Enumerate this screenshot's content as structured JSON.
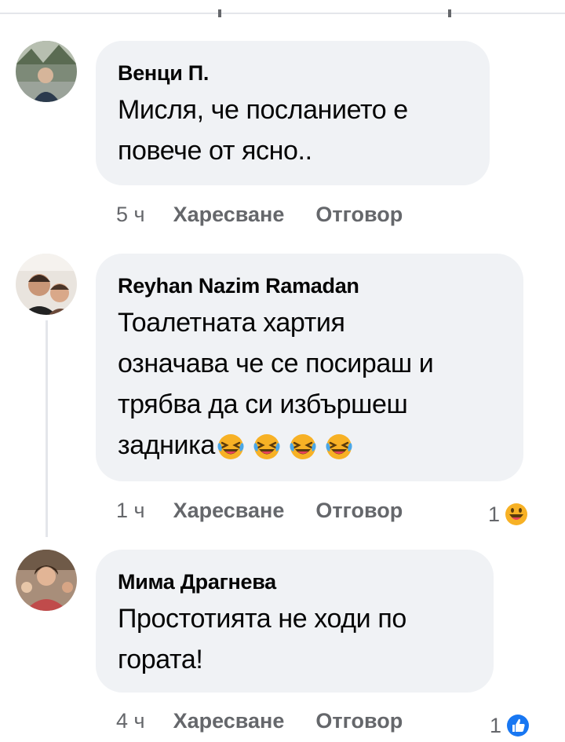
{
  "comments": [
    {
      "author": "Венци П.",
      "lines": [
        "Мисля, че посланието е",
        "повече от ясно.."
      ],
      "time": "5 ч",
      "like_label": "Харесване",
      "reply_label": "Отговор"
    },
    {
      "author": "Reyhan Nazim Ramadan",
      "lines": [
        "Тоалетната хартия",
        "означава че се посираш и",
        "трябва да си избършеш",
        "задника"
      ],
      "emoji": [
        "laughing-tears",
        "laughing-tears",
        "laughing-tears",
        "laughing-tears"
      ],
      "time": "1 ч",
      "like_label": "Харесване",
      "reply_label": "Отговор",
      "reaction_count": "1",
      "reaction_icon": "haha-icon"
    },
    {
      "author": "Мима Драгнева",
      "lines": [
        "Простотията не ходи по",
        "гората!"
      ],
      "time": "4 ч",
      "like_label": "Харесване",
      "reply_label": "Отговор",
      "reaction_count": "1",
      "reaction_icon": "like-icon"
    }
  ],
  "colors": {
    "bubble": "#f0f2f5",
    "text": "#050505",
    "meta": "#65676b",
    "like_blue": "#1877f2",
    "haha_yellow": "#f7b125"
  }
}
